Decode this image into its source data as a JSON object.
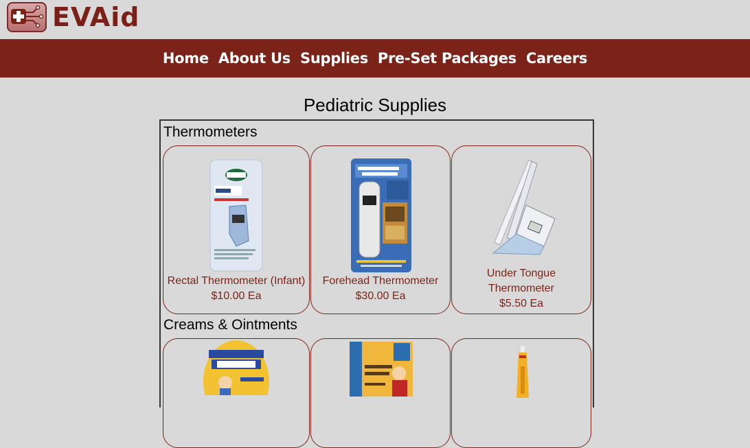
{
  "brand": {
    "name": "EVAid"
  },
  "nav": {
    "items": [
      "Home",
      "About Us",
      "Supplies",
      "Pre-Set Packages",
      "Careers"
    ]
  },
  "page": {
    "title": "Pediatric Supplies"
  },
  "sections": [
    {
      "title": "Thermometers",
      "products": [
        {
          "name": "Rectal Thermometer (Infant)",
          "price": "$10.00 Ea",
          "image": "vicks-baby-rectal-thermometer-box"
        },
        {
          "name": "Forehead Thermometer",
          "price": "$30.00 Ea",
          "image": "temporal-artery-thermometer-box"
        },
        {
          "name": "Under Tongue Thermometer",
          "price": "$5.50 Ea",
          "image": "digital-thermometer"
        }
      ]
    },
    {
      "title": "Creams & Ointments",
      "products": [
        {
          "name": "",
          "price": "",
          "image": "neosporin-neo-to-go"
        },
        {
          "name": "",
          "price": "",
          "image": "cream-box"
        },
        {
          "name": "",
          "price": "",
          "image": "ointment-tube"
        }
      ]
    }
  ],
  "colors": {
    "accent": "#7b2219",
    "background": "#d9d9d9"
  }
}
